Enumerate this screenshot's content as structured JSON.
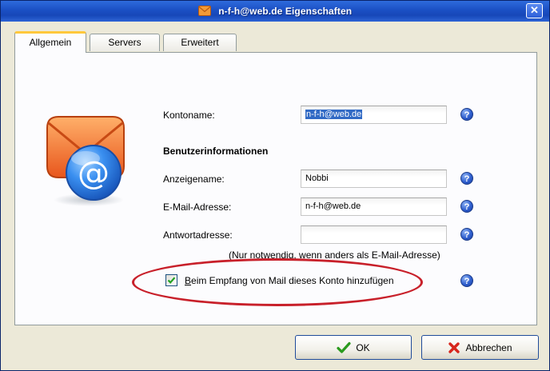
{
  "window": {
    "title": "n-f-h@web.de Eigenschaften",
    "close_glyph": "✕"
  },
  "tabs": [
    {
      "label": "Allgemein",
      "active": true
    },
    {
      "label": "Servers",
      "active": false
    },
    {
      "label": "Erweitert",
      "active": false
    }
  ],
  "form": {
    "kontoname_label": "Kontoname:",
    "kontoname_value": "n-f-h@web.de",
    "section_heading": "Benutzerinformationen",
    "anzeigename_label": "Anzeigename:",
    "anzeigename_value": "Nobbi",
    "email_label": "E-Mail-Adresse:",
    "email_value": "n-f-h@web.de",
    "antwort_label": "Antwortadresse:",
    "antwort_value": "",
    "antwort_hint": "(Nur notwendig, wenn anders als E-Mail-Adresse)",
    "checkbox_label": "Beim Empfang von Mail dieses Konto hinzufügen",
    "checkbox_checked": true,
    "help_glyph": "?"
  },
  "buttons": {
    "ok_label": "OK",
    "cancel_label": "Abbrechen"
  },
  "icons": {
    "title": "envelope-icon",
    "account": "mail-account-icon",
    "ok": "check-icon",
    "cancel": "x-icon"
  },
  "colors": {
    "titlebar": "#1b4fc4",
    "active_tab_accent": "#ffc83c",
    "highlight_ellipse": "#c8202a",
    "selection": "#316ac5"
  }
}
